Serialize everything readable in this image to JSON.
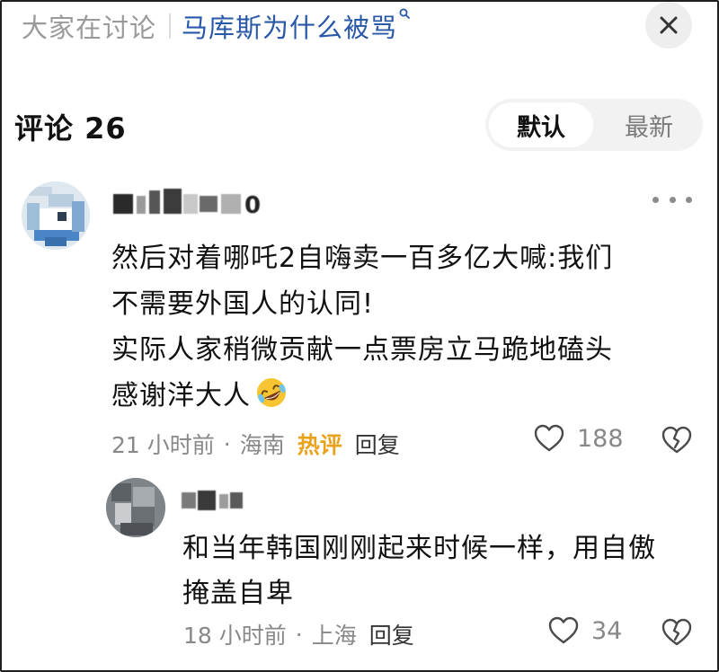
{
  "topbar": {
    "hint": "大家在讨论",
    "query": "马库斯为什么被骂",
    "query_icon": "search-icon"
  },
  "header": {
    "comments_label": "评论 26",
    "sort_options": [
      "默认",
      "最新"
    ],
    "sort_selected": "默认"
  },
  "comments": [
    {
      "username": "■■■■■■0",
      "text_lines": [
        "然后对着哪吒2自嗨卖一百多亿大喊:我们",
        "不需要外国人的认同!",
        "实际人家稍微贡献一点票房立马跪地磕头",
        "感谢洋大人"
      ],
      "emoji": "rofl-emoji",
      "time": "21 小时前",
      "dot": "·",
      "location": "海南",
      "tag": "热评",
      "reply_label": "回复",
      "likes": "188",
      "replies": [
        {
          "username": "■■■",
          "text_lines": [
            "和当年韩国刚刚起来时候一样，用自傲",
            "掩盖自卑"
          ],
          "time": "18 小时前",
          "dot": "·",
          "location": "上海",
          "reply_label": "回复",
          "likes": "34"
        }
      ]
    }
  ],
  "colors": {
    "link_blue": "#2a58a8",
    "hot_tag": "#e8a21c",
    "meta_gray": "#888888"
  }
}
